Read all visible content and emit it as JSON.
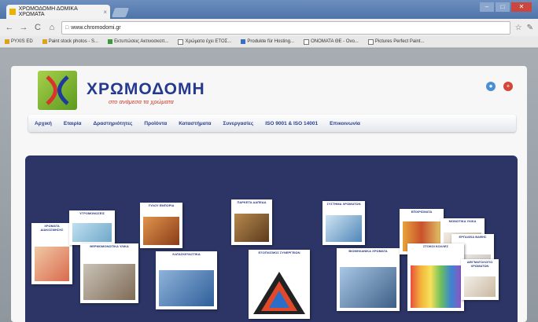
{
  "browser": {
    "tab_title": "ΧΡΩΜΟΔΟΜΗ ΔΟΜΙΚΑ ΧΡΩΜΑΤΑ",
    "tab_close": "×",
    "window_controls": {
      "minimize": "–",
      "maximize": "□",
      "close": "✕"
    },
    "back": "←",
    "forward": "→",
    "reload": "C",
    "home": "⌂",
    "url": "www.chromodomi.gr",
    "star": "☆",
    "wrench": "✎",
    "bookmarks": [
      {
        "label": "PYXIS ED"
      },
      {
        "label": "Paint stock photos - S..."
      },
      {
        "label": "Εκτυπώσεις Ακτινοσκοπ..."
      },
      {
        "label": "Χρώματα έχει ΕΤΟΣ..."
      },
      {
        "label": "Produkte für Hosting..."
      },
      {
        "label": "ΟΝΟΜΑΤΑ ΘΕ - Ονο..."
      },
      {
        "label": "Pictures Perfect Paint..."
      }
    ]
  },
  "site": {
    "brand": "ΧΡΩΜΟΔΟΜΗ",
    "slogan": "στο ανάμεσα τα χρώματα",
    "menu": [
      "Αρχική",
      "Εταιρία",
      "Δραστηριότητες",
      "Προϊόντα",
      "Καταστήματα",
      "Συνεργασίες",
      "ISO 9001 & ISO 14001",
      "Επικοινωνία"
    ],
    "cards": [
      {
        "label": "ΧΡΩΜΑΤΑ ΔΙΑΚΟΣΜΗΣΗΣ"
      },
      {
        "label": "ΥΓΡΟΜΟΝΩΣΕΙΣ"
      },
      {
        "label": "ΘΕΡΜΟΜΟΝΩΤΙΚΑ ΥΛΙΚΑ"
      },
      {
        "label": "ΞΥΛΟΥ ΕΜΠΟΡΙΑ"
      },
      {
        "label": "ΚΑΤΑΣΚΕΥΑΣΤΙΚΑ"
      },
      {
        "label": "ΠΑΡΚΕΤΑ ΔΑΠΕΔΑ"
      },
      {
        "label": "ΕΞΟΠΛΙΣΜΟΣ ΣΥΝΕΡΓΕΙΩΝ"
      },
      {
        "label": "ΣΥΣΤΗΜΑ ΧΡΩΜΑΤΩΝ"
      },
      {
        "label": "ΒΙΟΜΗΧΑΝΙΚΑ ΧΡΩΜΑΤΑ"
      },
      {
        "label": "ΕΠΙΧΡΙΣΜΑΤΑ"
      },
      {
        "label": "ΜΟΝΩΤΙΚΑ ΥΛΙΚΑ"
      },
      {
        "label": "ΕΡΓΑΛΕΙΑ ΒΑΦΗΣ"
      },
      {
        "label": "ΣΤΟΚΟΙ ΚΟΛΛΕΣ"
      },
      {
        "label": "ΔΕΙΓΜΑΤΟΛΟΓΙΟ ΧΡΩΜΑΤΩΝ"
      }
    ]
  },
  "colors": {
    "brand_blue": "#253a8e",
    "slogan_red": "#c83b2a",
    "panel": "#2c3566",
    "logo_green": "#7fb832"
  }
}
